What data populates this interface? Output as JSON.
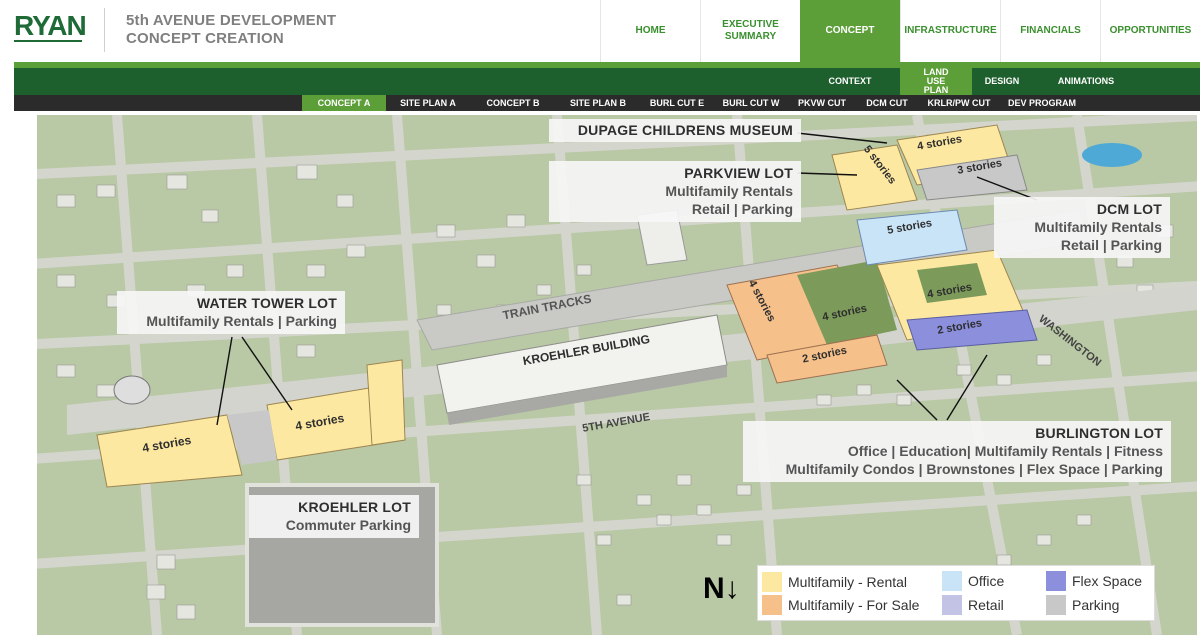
{
  "header": {
    "logo": "RYAN",
    "title_line1": "5th AVENUE DEVELOPMENT",
    "title_line2": "CONCEPT CREATION"
  },
  "topnav": [
    {
      "label": "HOME",
      "active": false
    },
    {
      "label": "EXECUTIVE SUMMARY",
      "active": false
    },
    {
      "label": "CONCEPT",
      "active": true
    },
    {
      "label": "INFRASTRUCTURE",
      "active": false
    },
    {
      "label": "FINANCIALS",
      "active": false
    },
    {
      "label": "OPPORTUNITIES",
      "active": false
    }
  ],
  "subnav": [
    {
      "label": "CONTEXT",
      "active": false
    },
    {
      "label": "LAND USE PLAN",
      "active": true
    },
    {
      "label": "DESIGN",
      "active": false
    },
    {
      "label": "ANIMATIONS",
      "active": false
    }
  ],
  "conceptnav": [
    {
      "label": "CONCEPT A",
      "active": true
    },
    {
      "label": "SITE PLAN A",
      "active": false
    },
    {
      "label": "CONCEPT B",
      "active": false
    },
    {
      "label": "SITE PLAN B",
      "active": false
    },
    {
      "label": "BURL  CUT E",
      "active": false
    },
    {
      "label": "BURL  CUT W",
      "active": false
    },
    {
      "label": "PKVW  CUT",
      "active": false
    },
    {
      "label": "DCM  CUT",
      "active": false
    },
    {
      "label": "KRLR/PW CUT",
      "active": false
    },
    {
      "label": "DEV PROGRAM",
      "active": false
    }
  ],
  "map": {
    "callouts": {
      "dupage": {
        "heading": "DUPAGE CHILDRENS MUSEUM"
      },
      "parkview": {
        "heading": "PARKVIEW LOT",
        "line1": "Multifamily Rentals",
        "line2": "Retail | Parking"
      },
      "dcm": {
        "heading": "DCM LOT",
        "line1": "Multifamily Rentals",
        "line2": "Retail | Parking"
      },
      "watertower": {
        "heading": "WATER TOWER LOT",
        "line1": "Multifamily Rentals | Parking"
      },
      "kroehler_lot": {
        "heading": "KROEHLER LOT",
        "line1": "Commuter Parking"
      },
      "burlington": {
        "heading": "BURLINGTON LOT",
        "line1": "Office | Education| Multifamily Rentals | Fitness",
        "line2": "Multifamily Condos | Brownstones | Flex Space | Parking"
      }
    },
    "labels": {
      "train_tracks": "TRAIN TRACKS",
      "kroehler_building": "KROEHLER BUILDING",
      "fifth_avenue": "5TH AVENUE",
      "washington": "WASHINGTON"
    },
    "stories": {
      "s5a": "5 stories",
      "s4a": "4 stories",
      "s3": "3 stories",
      "s5b": "5 stories",
      "s4b": "4 stories",
      "s4c": "4 stories",
      "s4d": "4 stories",
      "s2a": "2 stories",
      "s2b": "2 stories",
      "s4e": "4 stories",
      "s4f": "4 stories"
    },
    "north": "N↓"
  },
  "legend": {
    "items": [
      {
        "label": "Multifamily - Rental",
        "color": "#fde8a2"
      },
      {
        "label": "Multifamily - For Sale",
        "color": "#f6c08a"
      },
      {
        "label": "Office",
        "color": "#c9e3f7"
      },
      {
        "label": "Retail",
        "color": "#c3c3e6"
      },
      {
        "label": "Flex Space",
        "color": "#8b8fdc"
      },
      {
        "label": "Parking",
        "color": "#c8c8c8"
      }
    ]
  },
  "colors": {
    "brand_green": "#1e6b38",
    "accent_green": "#5c9e37",
    "dark_green": "#1e5f2e"
  }
}
